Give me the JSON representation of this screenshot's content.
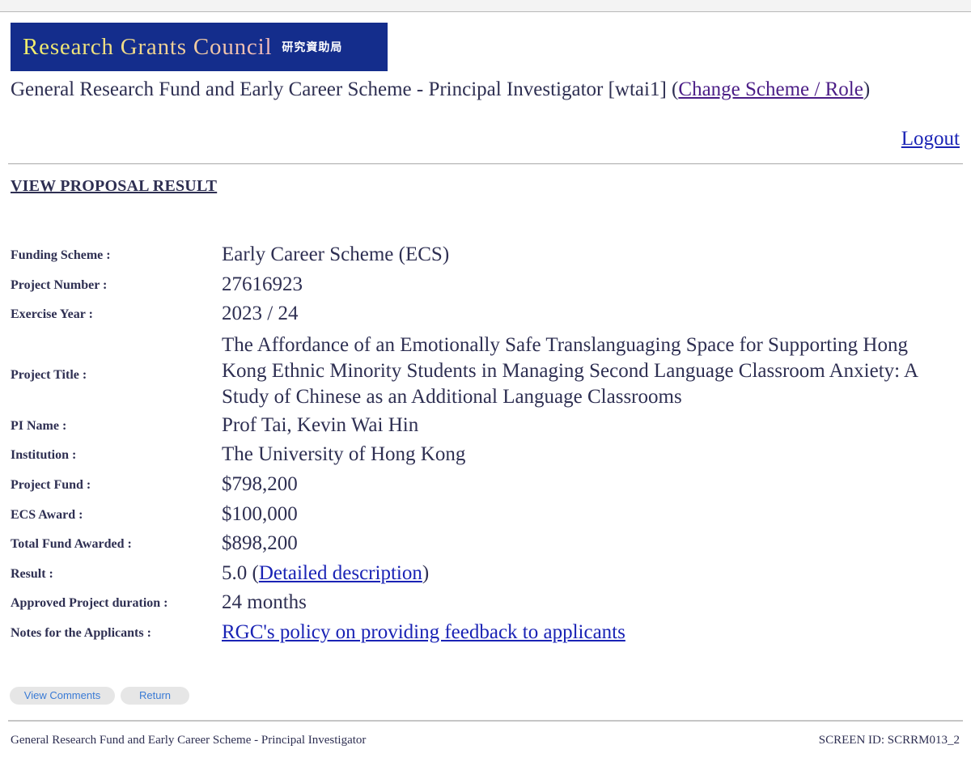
{
  "banner": {
    "title_en": "Research Grants Council",
    "title_zh": "研究資助局",
    "colors": {
      "background": "#142d8c",
      "text_gradient_start": "#f1ee6a",
      "text_gradient_end": "#f0b9bc"
    }
  },
  "header": {
    "scheme_text": "General Research Fund and Early Career Scheme - Principal Investigator [wtai1] (",
    "change_link": "Change Scheme / Role",
    "scheme_text_end": ")",
    "logout_label": "Logout"
  },
  "page": {
    "heading": "VIEW PROPOSAL RESULT"
  },
  "details": {
    "funding_scheme": {
      "label": "Funding Scheme :",
      "value": "Early Career Scheme (ECS)"
    },
    "project_number": {
      "label": "Project Number :",
      "value": "27616923"
    },
    "exercise_year": {
      "label": "Exercise Year :",
      "value": "2023 / 24"
    },
    "project_title": {
      "label": "Project Title :",
      "value": "The Affordance of an Emotionally Safe Translanguaging Space for Supporting Hong Kong Ethnic Minority Students in Managing Second Language Classroom Anxiety: A Study of Chinese as an Additional Language Classrooms"
    },
    "pi_name": {
      "label": "PI Name :",
      "value": "Prof Tai, Kevin Wai Hin"
    },
    "institution": {
      "label": "Institution :",
      "value": "The University of Hong Kong"
    },
    "project_fund": {
      "label": "Project Fund :",
      "value": "$798,200"
    },
    "ecs_award": {
      "label": "ECS Award :",
      "value": "$100,000"
    },
    "total_fund": {
      "label": "Total Fund Awarded :",
      "value": "$898,200"
    },
    "result": {
      "label": "Result :",
      "value": "5.0",
      "open_paren": " (",
      "link": "Detailed description",
      "close_paren": ")"
    },
    "duration": {
      "label": "Approved Project duration :",
      "value": "24 months"
    },
    "notes": {
      "label": "Notes for the Applicants :",
      "link": "RGC's policy on providing feedback to applicants"
    }
  },
  "buttons": {
    "view_comments": "View Comments",
    "return": "Return"
  },
  "footer": {
    "left": "General Research Fund and Early Career Scheme - Principal Investigator",
    "right": "SCREEN ID: SCRRM013_2"
  },
  "colors": {
    "text": "#2e2f52",
    "link": "#1a23b5",
    "visited_link": "#4b1d86",
    "button_bg": "#e6e6e6",
    "button_text": "#3a7bd5"
  }
}
